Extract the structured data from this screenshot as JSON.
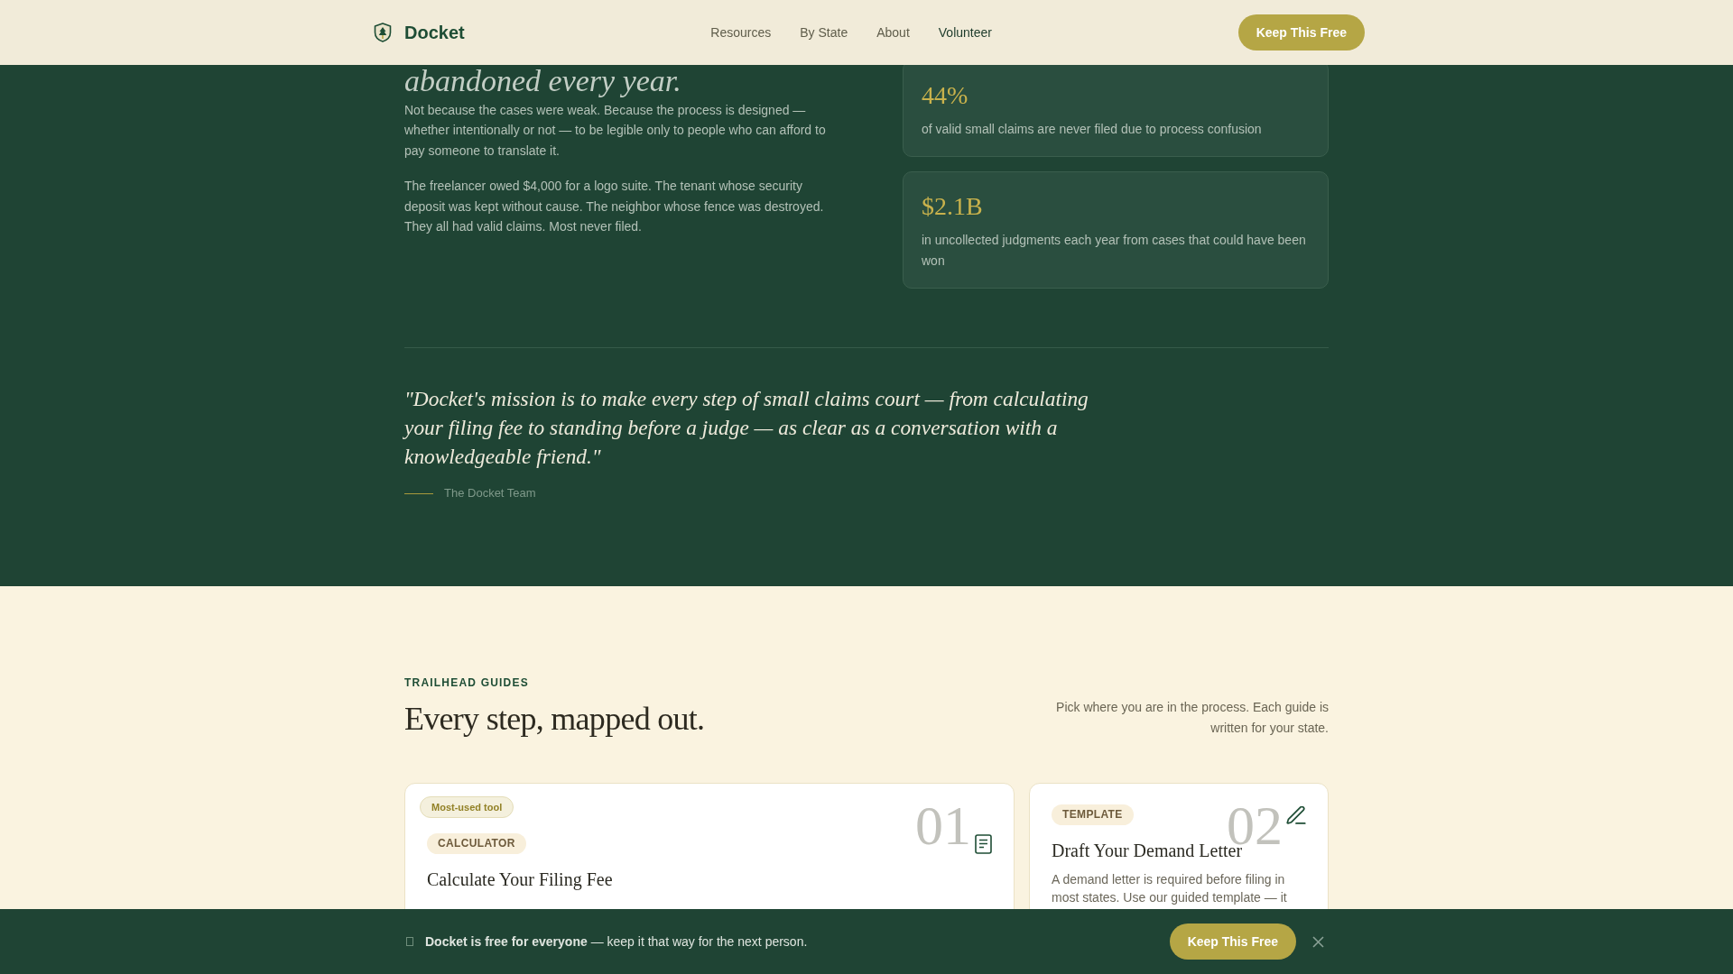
{
  "header": {
    "brand": "Docket",
    "nav": [
      {
        "label": "Resources",
        "selected": false
      },
      {
        "label": "By State",
        "selected": false
      },
      {
        "label": "About",
        "selected": false
      },
      {
        "label": "Volunteer",
        "selected": true
      }
    ],
    "cta": "Keep This Free"
  },
  "mission": {
    "heading": "abandoned every year.",
    "paragraphs": [
      "Not because the cases were weak. Because the process is designed — whether intentionally or not — to be legible only to people who can afford to pay someone to translate it.",
      "The freelancer owed $4,000 for a logo suite. The tenant whose security deposit was kept without cause. The neighbor whose fence was destroyed. They all had valid claims. Most never filed."
    ],
    "stats": [
      {
        "value": "44%",
        "description": "of valid small claims are never filed due to process confusion"
      },
      {
        "value": "$2.1B",
        "description": "in uncollected judgments each year from cases that could have been won"
      }
    ],
    "quote": "\"Docket's mission is to make every step of small claims court — from calculating your filing fee to standing before a judge — as clear as a conversation with a knowledgeable friend.\"",
    "attribution": "The Docket Team"
  },
  "guides": {
    "eyebrow": "TRAILHEAD GUIDES",
    "title": "Every step, mapped out.",
    "intro": "Pick where you are in the process. Each guide is written for your state.",
    "cards": [
      {
        "kind": "calculator",
        "badge": "Most-used tool",
        "category": "CALCULATOR",
        "number": "01",
        "title": "Calculate Your Filing Fee"
      },
      {
        "kind": "template",
        "category": "TEMPLATE",
        "number": "02",
        "title": "Draft Your Demand Letter",
        "description": "A demand letter is required before filing in most states. Use our guided template — it"
      }
    ]
  },
  "banner": {
    "message": "**Docket is free for everyone** — keep it that way for the next person.",
    "cta": "Keep This Free"
  }
}
